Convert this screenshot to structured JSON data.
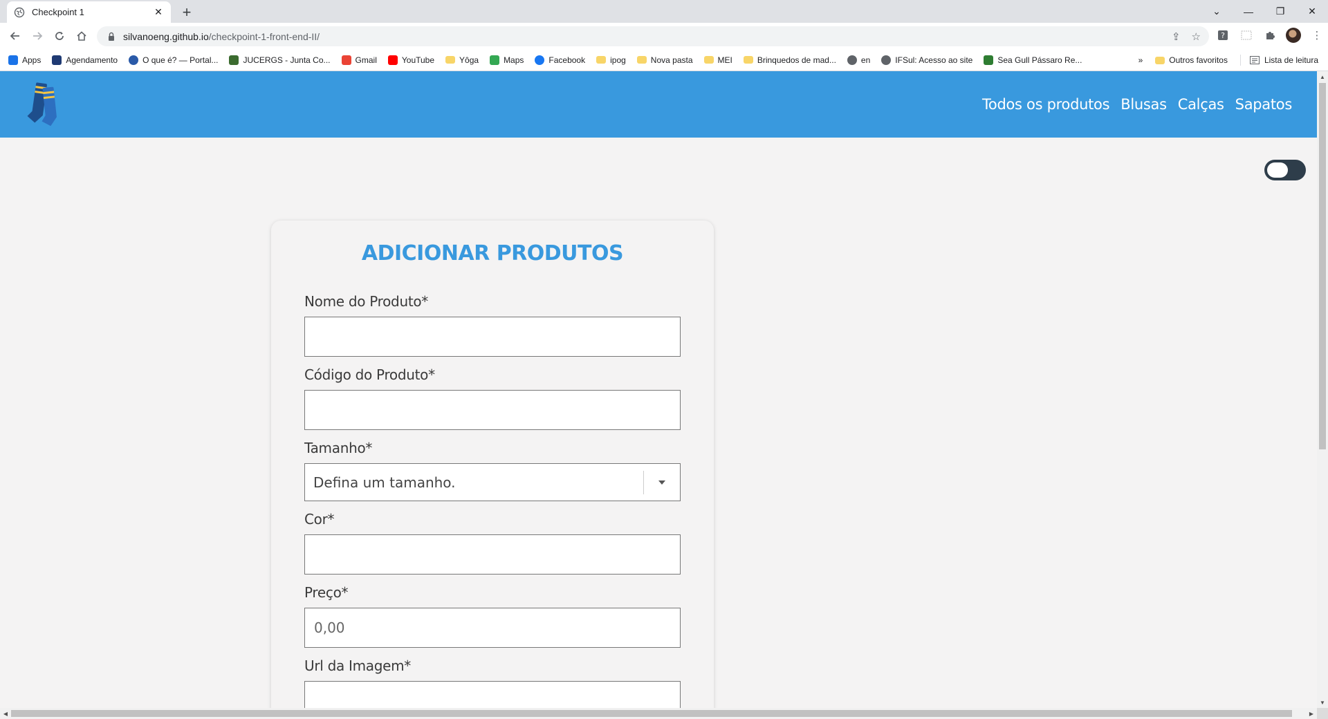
{
  "browser": {
    "tab_title": "Checkpoint 1",
    "tab_close": "✕",
    "new_tab": "+",
    "url_host": "silvanoeng.github.io",
    "url_path": "/checkpoint-1-front-end-II/",
    "window_controls": {
      "dropdown": "⌄",
      "minimize": "—",
      "restore": "❐",
      "close": "✕"
    }
  },
  "bookmarks": {
    "items": [
      {
        "label": "Apps",
        "icon": "apps-grid-icon",
        "color": "#1a73e8"
      },
      {
        "label": "Agendamento",
        "icon": "agendamento-icon",
        "color": "#1f3a73"
      },
      {
        "label": "O que é? — Portal...",
        "icon": "portal-icon",
        "color": "#2a5aa8"
      },
      {
        "label": "JUCERGS - Junta Co...",
        "icon": "jucergs-icon",
        "color": "#3b6b2f"
      },
      {
        "label": "Gmail",
        "icon": "gmail-icon",
        "color": "#ea4335"
      },
      {
        "label": "YouTube",
        "icon": "youtube-icon",
        "color": "#ff0000"
      },
      {
        "label": "Yôga",
        "icon": "folder-icon",
        "color": "#f8d568"
      },
      {
        "label": "Maps",
        "icon": "maps-icon",
        "color": "#34a853"
      },
      {
        "label": "Facebook",
        "icon": "facebook-icon",
        "color": "#1877f2"
      },
      {
        "label": "ipog",
        "icon": "folder-icon",
        "color": "#f8d568"
      },
      {
        "label": "Nova pasta",
        "icon": "folder-icon",
        "color": "#f8d568"
      },
      {
        "label": "MEI",
        "icon": "folder-icon",
        "color": "#f8d568"
      },
      {
        "label": "Brinquedos de mad...",
        "icon": "folder-icon",
        "color": "#f8d568"
      },
      {
        "label": "en",
        "icon": "globe-icon",
        "color": "#5f6368"
      },
      {
        "label": "IFSul: Acesso ao site",
        "icon": "globe-icon",
        "color": "#5f6368"
      },
      {
        "label": "Sea Gull Pássaro Re...",
        "icon": "px-icon",
        "color": "#2e7d32"
      }
    ],
    "overflow": "»",
    "other_favorites": "Outros favoritos",
    "reading_list": "Lista de leitura"
  },
  "site": {
    "brand_color": "#3999de",
    "nav": [
      "Todos os produtos",
      "Blusas",
      "Calças",
      "Sapatos"
    ],
    "theme_toggle": "off"
  },
  "form": {
    "title": "ADICIONAR PRODUTOS",
    "name_label": "Nome do Produto*",
    "name_value": "",
    "code_label": "Código do Produto*",
    "code_value": "",
    "size_label": "Tamanho*",
    "size_selected": "Defina um tamanho.",
    "color_label": "Cor*",
    "color_value": "",
    "price_label": "Preço*",
    "price_placeholder": "0,00",
    "image_label": "Url da Imagem*",
    "image_value": ""
  }
}
